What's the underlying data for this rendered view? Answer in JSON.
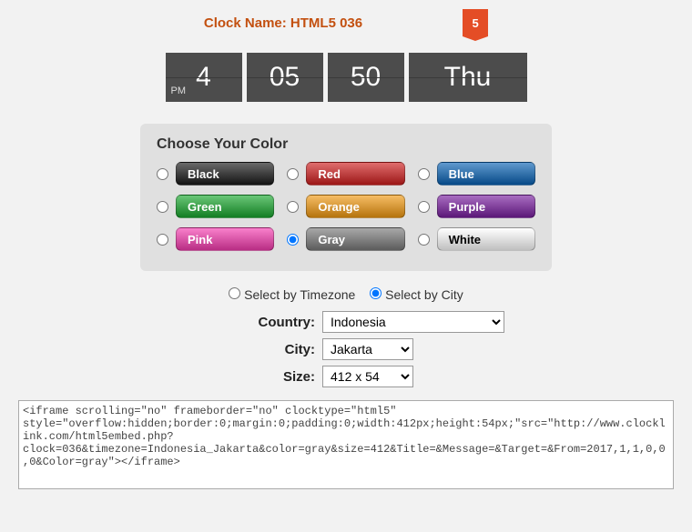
{
  "title": {
    "label": "Clock Name:",
    "name": "HTML5 036",
    "badge": "5"
  },
  "clock": {
    "ampm": "PM",
    "hour": "4",
    "minute": "05",
    "second": "50",
    "day": "Thu"
  },
  "colorPanel": {
    "heading": "Choose Your Color",
    "options": [
      {
        "label": "Black",
        "bg": "#1a1a1a",
        "fg": "#ffffff",
        "selected": false
      },
      {
        "label": "Red",
        "bg": "#d01f1f",
        "fg": "#ffffff",
        "selected": false
      },
      {
        "label": "Blue",
        "bg": "#0a63b5",
        "fg": "#ffffff",
        "selected": false
      },
      {
        "label": "Green",
        "bg": "#1aa82f",
        "fg": "#ffffff",
        "selected": false
      },
      {
        "label": "Orange",
        "bg": "#f29a12",
        "fg": "#ffffff",
        "selected": false
      },
      {
        "label": "Purple",
        "bg": "#7a1fa0",
        "fg": "#ffffff",
        "selected": false
      },
      {
        "label": "Pink",
        "bg": "#f63cb0",
        "fg": "#ffffff",
        "selected": false
      },
      {
        "label": "Gray",
        "bg": "#7a7a7a",
        "fg": "#ffffff",
        "selected": true
      },
      {
        "label": "White",
        "bg": "#ffffff",
        "fg": "#000000",
        "selected": false
      }
    ]
  },
  "modeSelect": {
    "timezone": {
      "label": "Select by Timezone",
      "selected": false
    },
    "city": {
      "label": "Select by City",
      "selected": true
    }
  },
  "form": {
    "countryLabel": "Country:",
    "country": "Indonesia",
    "cityLabel": "City:",
    "city": "Jakarta",
    "sizeLabel": "Size:",
    "size": "412 x 54"
  },
  "embed": "<iframe scrolling=\"no\" frameborder=\"no\" clocktype=\"html5\" style=\"overflow:hidden;border:0;margin:0;padding:0;width:412px;height:54px;\"src=\"http://www.clocklink.com/html5embed.php?clock=036&timezone=Indonesia_Jakarta&color=gray&size=412&Title=&Message=&Target=&From=2017,1,1,0,0,0&Color=gray\"></iframe>"
}
